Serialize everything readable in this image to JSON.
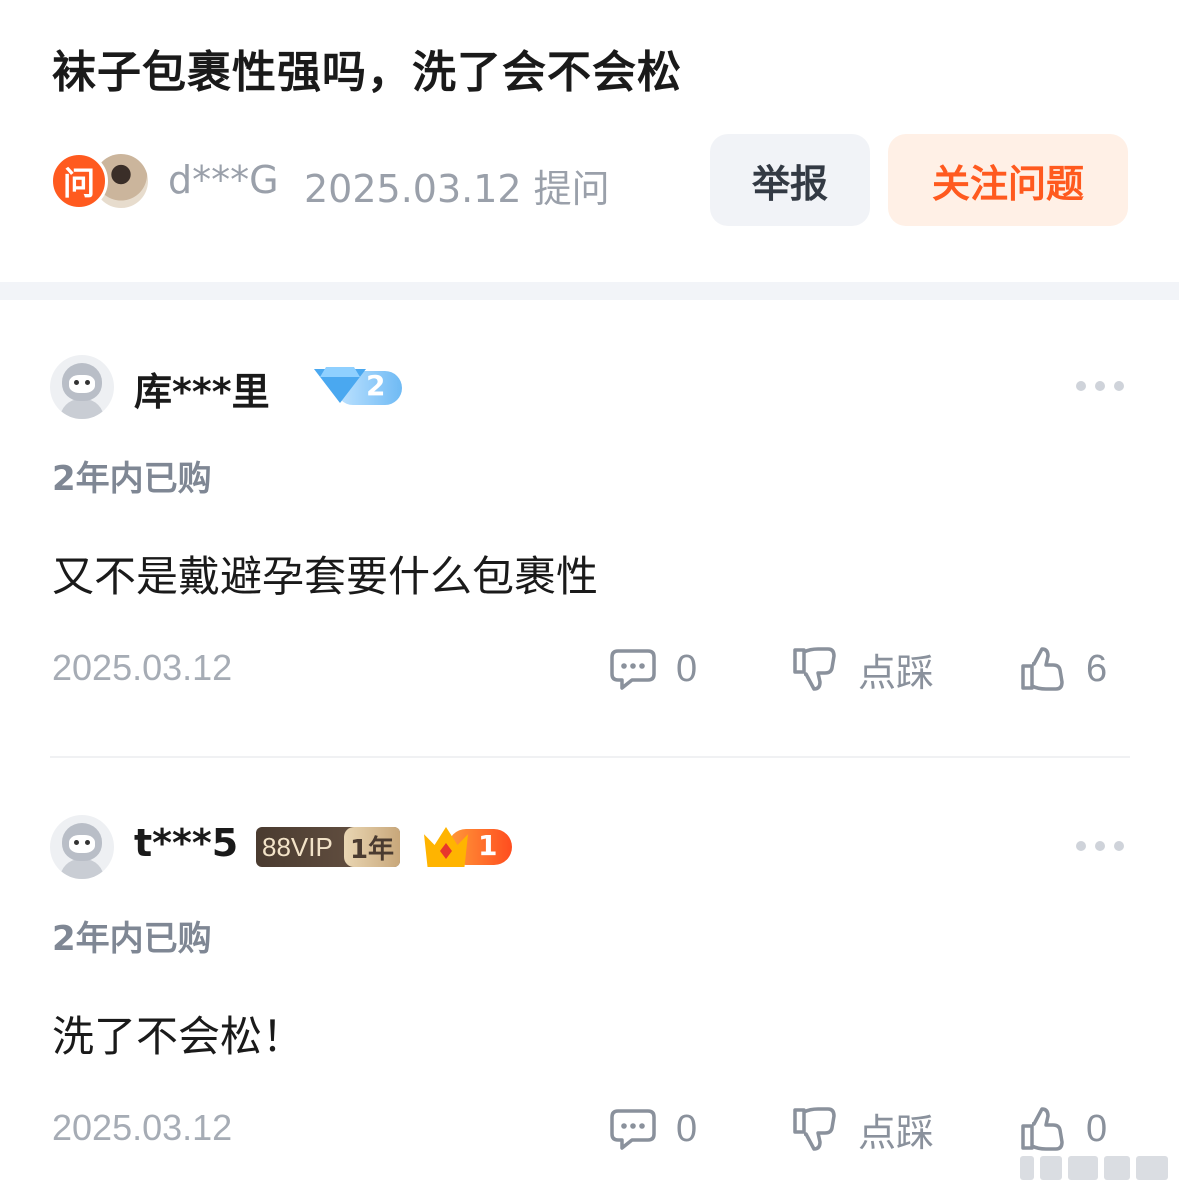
{
  "question": {
    "title": "袜子包裹性强吗，洗了会不会松",
    "ask_badge": "问",
    "asker_name": "d***G",
    "asked_date": "2025.03.12 提问",
    "report_label": "举报",
    "follow_label": "关注问题"
  },
  "colors": {
    "accent": "#ff5a1f",
    "accent_bg": "#fff0e6",
    "muted_text": "#9aa0aa"
  },
  "answers": [
    {
      "user_name": "库***里",
      "badge": {
        "type": "diamond-icon",
        "level": "2"
      },
      "purchase_tag": "2年内已购",
      "text": "又不是戴避孕套要什么包裹性",
      "date": "2025.03.12",
      "comment_count": "0",
      "dislike_label": "点踩",
      "like_count": "6"
    },
    {
      "user_name": "t***5",
      "badge": {
        "type": "88vip-icon",
        "vip_label": "88VIP",
        "vip_year": "1年",
        "crown_level": "1"
      },
      "purchase_tag": "2年内已购",
      "text": "洗了不会松！",
      "date": "2025.03.12",
      "comment_count": "0",
      "dislike_label": "点踩",
      "like_count": "0"
    }
  ]
}
